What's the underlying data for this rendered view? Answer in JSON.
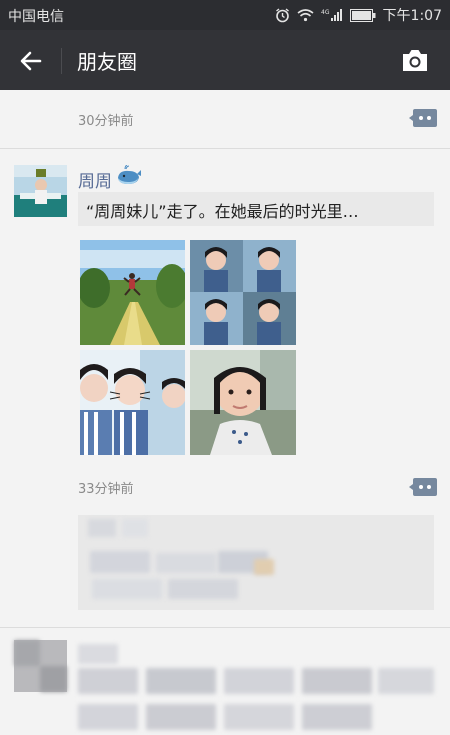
{
  "status_bar": {
    "carrier": "中国电信",
    "time": "下午1:07"
  },
  "nav": {
    "title": "朋友圈",
    "back_icon": "arrow-left-icon",
    "camera_icon": "camera-icon"
  },
  "posts": [
    {
      "time": "30分钟前"
    },
    {
      "nickname": "周周",
      "share_title": "“周周妹儿”走了。在她最后的时光里…",
      "time": "33分钟前"
    }
  ],
  "colors": {
    "nav_bg": "#323337",
    "status_bg": "#2c2d31",
    "link": "#576b95",
    "feed_bg": "#f3f3f3"
  }
}
